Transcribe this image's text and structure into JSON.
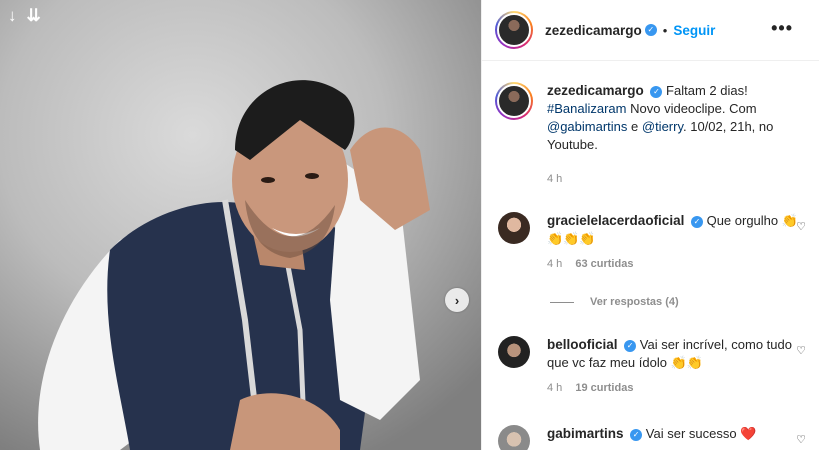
{
  "post": {
    "image_alt": "Man in navy vest and white shirt smiling, hand on head",
    "next_icon": "chevron-right-icon",
    "top_icons": [
      "arrow-down-icon",
      "double-arrow-down-icon"
    ]
  },
  "header": {
    "username": "zezedicamargo",
    "separator": "•",
    "follow_label": "Seguir",
    "more_label": "•••"
  },
  "caption": {
    "username": "zezedicamargo",
    "text_1": "Faltam 2 dias!",
    "hashtag": "#Banalizaram",
    "text_2": " Novo videoclipe. Com",
    "mention_1": "@gabimartins",
    "text_3": " e ",
    "mention_2": "@tierry",
    "text_4": ". 10/02, 21h, no Youtube.",
    "time": "4 h"
  },
  "comments": [
    {
      "username": "gracielelacerdaoficial",
      "text": "Que orgulho 👏👏👏👏",
      "time": "4 h",
      "likes": "63 curtidas"
    },
    {
      "username": "bellooficial",
      "text": "Vai ser incrível, como tudo que vc faz meu ídolo 👏👏",
      "time": "4 h",
      "likes": "19 curtidas"
    },
    {
      "username": "gabimartins",
      "text": "Vai ser sucesso ❤️",
      "time": "",
      "likes": ""
    }
  ],
  "replies_label": "Ver respostas (4)",
  "colors": {
    "accent": "#0095f6",
    "verified": "#3897f0",
    "link": "#00376b"
  }
}
